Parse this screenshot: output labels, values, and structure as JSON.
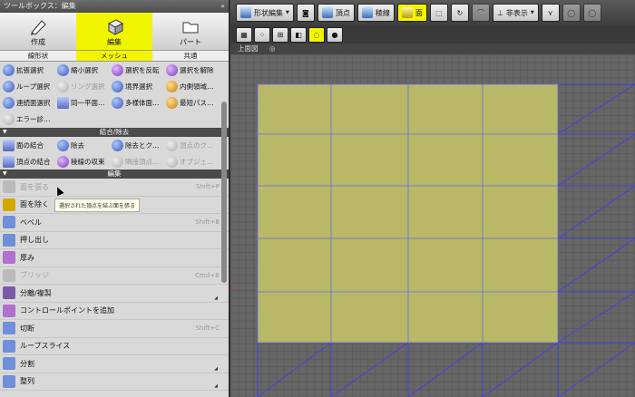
{
  "left_panel": {
    "title": "ツールボックス：編集",
    "collapse": "«",
    "modes": [
      {
        "label": "作成",
        "icon": "pen-icon",
        "active": false
      },
      {
        "label": "編集",
        "icon": "cube-edit-icon",
        "active": true
      },
      {
        "label": "パート",
        "icon": "folder-icon",
        "active": false
      }
    ],
    "subtabs": [
      {
        "label": "線形状",
        "active": false
      },
      {
        "label": "メッシュ",
        "active": true
      },
      {
        "label": "共通",
        "active": false
      }
    ],
    "select_tools": [
      {
        "label": "拡張選択",
        "color": "blue",
        "dim": false
      },
      {
        "label": "縮小選択",
        "color": "blue",
        "dim": false
      },
      {
        "label": "選択を反転",
        "color": "purple",
        "dim": false
      },
      {
        "label": "選択を解除",
        "color": "purple",
        "dim": false
      },
      {
        "label": "ループ選択",
        "color": "blue",
        "dim": false
      },
      {
        "label": "リング選択",
        "color": "gray",
        "dim": true
      },
      {
        "label": "境界選択",
        "color": "blue",
        "dim": false
      },
      {
        "label": "内側領域…",
        "color": "orange",
        "dim": false
      },
      {
        "label": "連続面選択",
        "color": "blue",
        "dim": false
      },
      {
        "label": "同一平面…",
        "color": "sq",
        "dim": false
      },
      {
        "label": "多様体面…",
        "color": "blue",
        "dim": false
      },
      {
        "label": "最短パス…",
        "color": "orange",
        "dim": false
      }
    ],
    "error_tool": "エラー診…",
    "section_join": "結合/除去",
    "join_tools": [
      {
        "label": "面の結合",
        "color": "sq",
        "dim": false
      },
      {
        "label": "除去",
        "color": "blue",
        "dim": false
      },
      {
        "label": "除去とク…",
        "color": "blue",
        "dim": false
      },
      {
        "label": "頂点のク…",
        "color": "gray",
        "dim": true
      },
      {
        "label": "頂点の結合",
        "color": "sq",
        "dim": false
      },
      {
        "label": "稜線の収束",
        "color": "purple",
        "dim": false
      },
      {
        "label": "隣接頂点…",
        "color": "gray",
        "dim": true
      },
      {
        "label": "オブジェ…",
        "color": "gray",
        "dim": true
      }
    ],
    "section_edit": "編集",
    "edit_tools": [
      {
        "label": "面を張る",
        "shortcut": "Shift+P",
        "dim": true,
        "more": false,
        "color": "#bbbbbb"
      },
      {
        "label": "面を除く",
        "shortcut": "",
        "dim": false,
        "more": false,
        "color": "#d0a800"
      },
      {
        "label": "ベベル",
        "shortcut": "Shift+B",
        "dim": false,
        "more": false,
        "color": "#6f8fd8"
      },
      {
        "label": "押し出し",
        "shortcut": "",
        "dim": false,
        "more": false,
        "color": "#6f8fd8"
      },
      {
        "label": "厚み",
        "shortcut": "",
        "dim": false,
        "more": false,
        "color": "#b070d0"
      },
      {
        "label": "ブリッジ",
        "shortcut": "Cmd+B",
        "dim": true,
        "more": false,
        "color": "#bbbbbb"
      },
      {
        "label": "分離/複製",
        "shortcut": "",
        "dim": false,
        "more": true,
        "color": "#7a5aa8"
      },
      {
        "label": "コントロールポイントを追加",
        "shortcut": "",
        "dim": false,
        "more": false,
        "color": "#b070d0"
      },
      {
        "label": "切断",
        "shortcut": "Shift+C",
        "dim": false,
        "more": false,
        "color": "#6f8fd8"
      },
      {
        "label": "ループスライス",
        "shortcut": "",
        "dim": false,
        "more": false,
        "color": "#6f8fd8"
      },
      {
        "label": "分割",
        "shortcut": "",
        "dim": false,
        "more": true,
        "color": "#6f8fd8"
      },
      {
        "label": "整列",
        "shortcut": "",
        "dim": false,
        "more": true,
        "color": "#6f8fd8"
      }
    ],
    "tooltip": "選択された頂点を結ぶ面を張る"
  },
  "toolbar": {
    "shape_edit": "形状編集",
    "vertex": "頂点",
    "edge": "稜線",
    "face": "面",
    "hidden": "非表示",
    "view_label": "上面図",
    "view_target": "◎"
  },
  "colors": {
    "face_fill": "#b8b866",
    "mesh_line": "#3c3cff",
    "accent": "#f2f500"
  }
}
